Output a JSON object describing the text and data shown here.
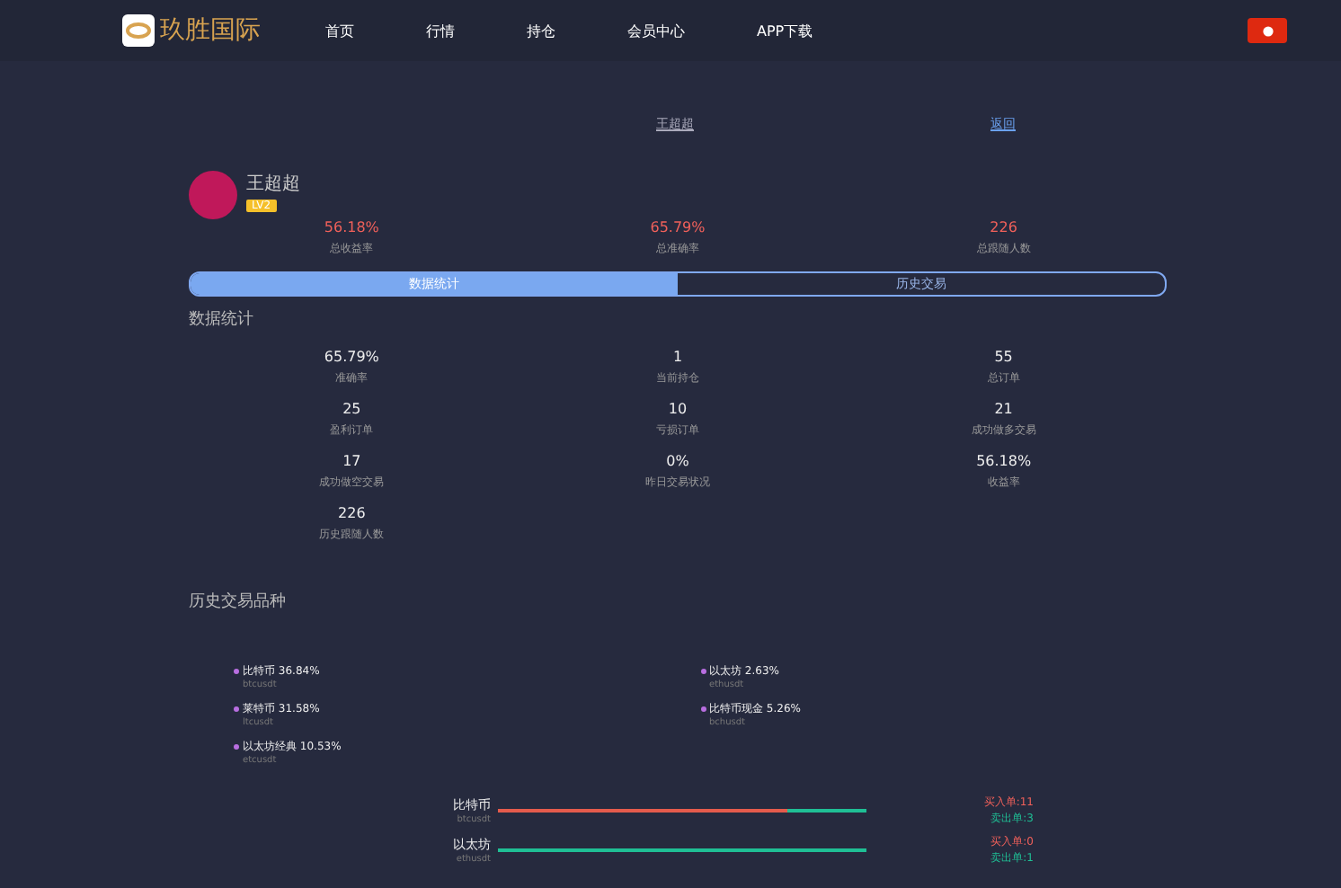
{
  "header": {
    "logo_text": "玖胜国际",
    "nav": [
      {
        "label": "首页"
      },
      {
        "label": "行情"
      },
      {
        "label": "持仓"
      },
      {
        "label": "会员中心"
      },
      {
        "label": "APP下载"
      }
    ]
  },
  "top_links": {
    "name": "王超超",
    "back": "返回"
  },
  "profile": {
    "name": "王超超",
    "badge": "LV2"
  },
  "summary": [
    {
      "value": "56.18%",
      "label": "总收益率"
    },
    {
      "value": "65.79%",
      "label": "总准确率"
    },
    {
      "value": "226",
      "label": "总跟随人数"
    }
  ],
  "tabs": [
    {
      "label": "数据统计",
      "selected": true
    },
    {
      "label": "历史交易",
      "selected": false
    }
  ],
  "stats_title": "数据统计",
  "stats": [
    {
      "value": "65.79%",
      "label": "准确率"
    },
    {
      "value": "1",
      "label": "当前持仓"
    },
    {
      "value": "55",
      "label": "总订单"
    },
    {
      "value": "25",
      "label": "盈利订单"
    },
    {
      "value": "10",
      "label": "亏损订单"
    },
    {
      "value": "21",
      "label": "成功做多交易"
    },
    {
      "value": "17",
      "label": "成功做空交易"
    },
    {
      "value": "0%",
      "label": "昨日交易状况"
    },
    {
      "value": "56.18%",
      "label": "收益率"
    },
    {
      "value": "226",
      "label": "历史跟随人数"
    }
  ],
  "varieties_title": "历史交易品种",
  "legend": [
    {
      "name": "比特币 36.84%",
      "symbol": "btcusdt",
      "color": "#b86ee0"
    },
    {
      "name": "以太坊 2.63%",
      "symbol": "ethusdt",
      "color": "#b86ee0"
    },
    {
      "name": "莱特币 31.58%",
      "symbol": "ltcusdt",
      "color": "#b86ee0"
    },
    {
      "name": "比特币现金 5.26%",
      "symbol": "bchusdt",
      "color": "#b86ee0"
    },
    {
      "name": "以太坊经典 10.53%",
      "symbol": "etcusdt",
      "color": "#b86ee0"
    }
  ],
  "trades": [
    {
      "name": "比特币",
      "symbol": "btcusdt",
      "level": 0.786,
      "buy": "买入单:11",
      "sell": "卖出单:3"
    },
    {
      "name": "以太坊",
      "symbol": "ethusdt",
      "level": 0,
      "buy": "买入单:0",
      "sell": "卖出单:1"
    }
  ]
}
